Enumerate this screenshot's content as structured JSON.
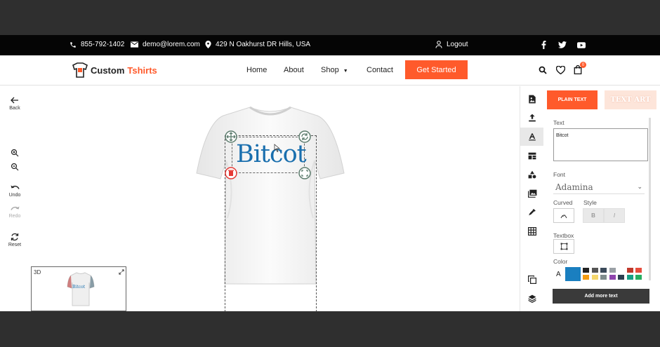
{
  "topbar": {
    "phone": "855-792-1402",
    "email": "demo@lorem.com",
    "address": "429 N Oakhurst DR Hills, USA",
    "logout": "Logout",
    "social": [
      "facebook-icon",
      "twitter-icon",
      "youtube-icon"
    ]
  },
  "header": {
    "logo_part1": "Custom",
    "logo_part2": "Tshirts",
    "nav": [
      "Home",
      "About",
      "Shop",
      "Contact"
    ],
    "cta": "Get Started",
    "cart_count": "0"
  },
  "left_tools": {
    "back": "Back",
    "undo": "Undo",
    "redo": "Redo",
    "reset": "Reset"
  },
  "canvas": {
    "design_text": "Bitcot",
    "preview_label": "3D",
    "preview_text": "Bitcot"
  },
  "panel": {
    "tab_plain": "PLAIN TEXT",
    "tab_art": "TEXT ART",
    "text_label": "Text",
    "text_value": "Bitcot",
    "font_label": "Font",
    "font_value": "Adamina",
    "curved_label": "Curved",
    "style_label": "Style",
    "bold": "B",
    "italic": "I",
    "textbox_label": "Textbox",
    "color_label": "Color",
    "color_prefix": "A",
    "selected_color": "#1a7fc0",
    "swatches": [
      "#222222",
      "#555555",
      "#3b4a5a",
      "#9aa0a6",
      "#ffffff",
      "#c0392b",
      "#e74c3c",
      "#f39c12",
      "#f5d76e",
      "#7f8c8d",
      "#8e44ad",
      "#2c3e50",
      "#16a085",
      "#27ae60"
    ],
    "add_button": "Add more text"
  },
  "colors": {
    "accent": "#ff5a2b",
    "design_text": "#1a6fae"
  }
}
